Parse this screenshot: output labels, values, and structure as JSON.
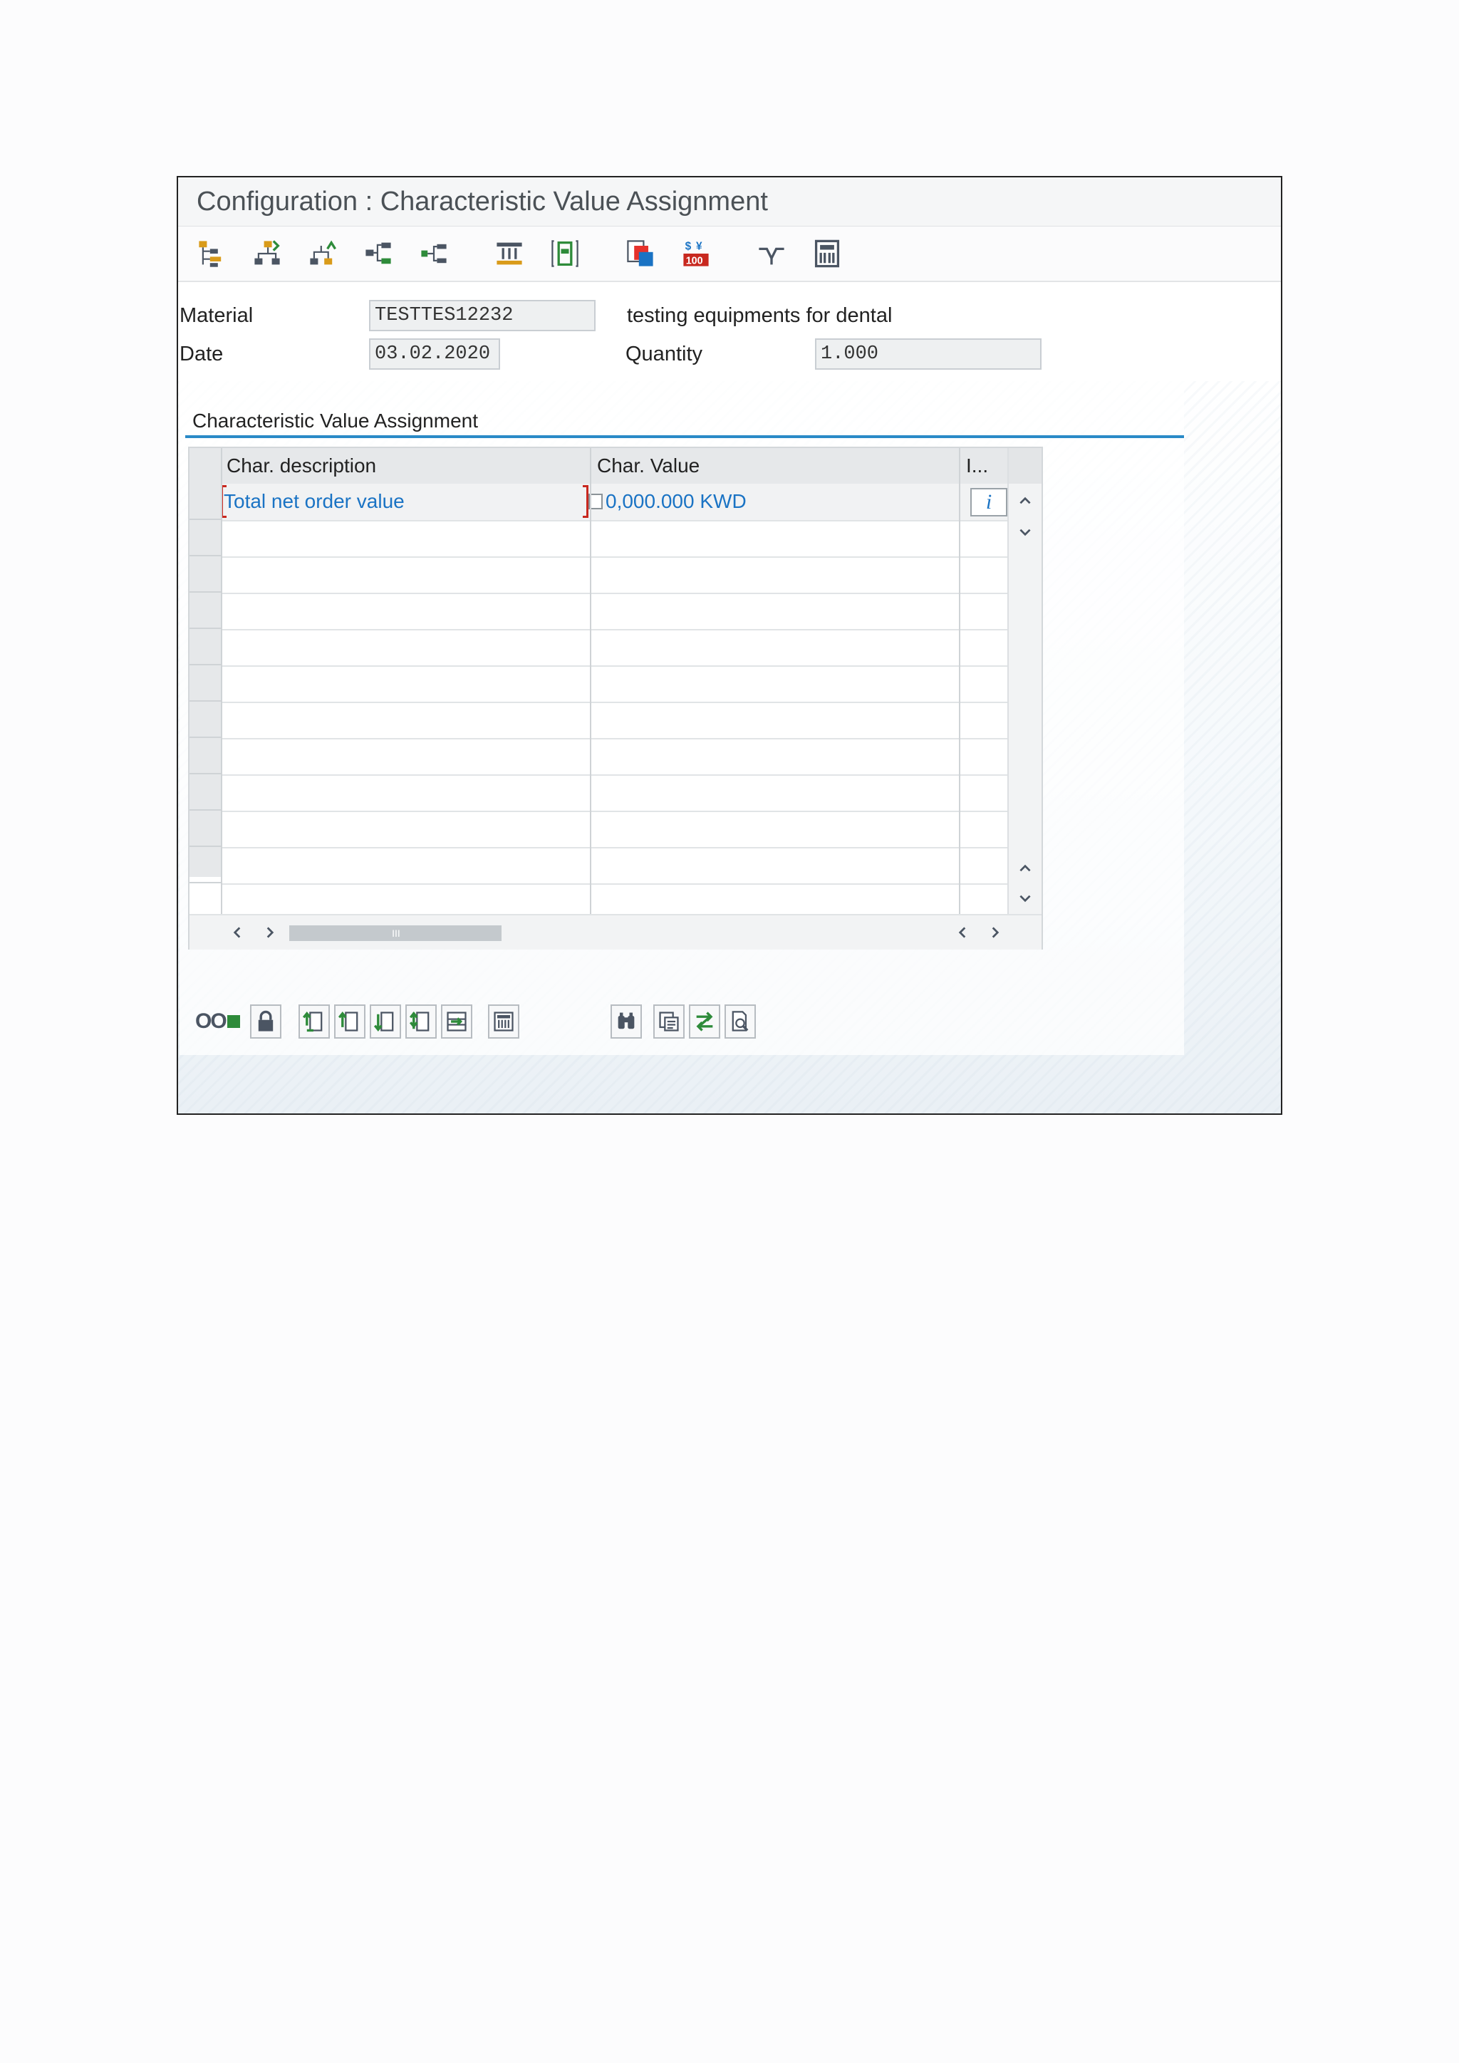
{
  "window": {
    "title": "Configuration : Characteristic Value Assignment"
  },
  "toolbar": {
    "icons": [
      "structure-icon",
      "expand-down-icon",
      "expand-up-icon",
      "hierarchy-icon",
      "subtree-icon",
      "columns-icon",
      "form-icon",
      "copy-object-icon",
      "price-icon",
      "result-icon",
      "calculator-icon"
    ]
  },
  "header": {
    "material_label": "Material",
    "material_value": "TESTTES12232",
    "material_desc": "testing equipments for dental",
    "date_label": "Date",
    "date_value": "03.02.2020",
    "quantity_label": "Quantity",
    "quantity_value": "1.000"
  },
  "group": {
    "title": "Characteristic Value Assignment"
  },
  "table": {
    "columns": [
      "Char. description",
      "Char. Value",
      "I..."
    ],
    "rows": [
      {
        "description": "Total net order value",
        "value": "0,000.000 KWD"
      }
    ],
    "info_glyph": "i"
  },
  "scroll": {
    "hgrip": "III"
  },
  "bottom_toolbar": {
    "status_glyph": "OO"
  },
  "colors": {
    "accent": "#2a8ac7",
    "link_text": "#1a73c4"
  }
}
